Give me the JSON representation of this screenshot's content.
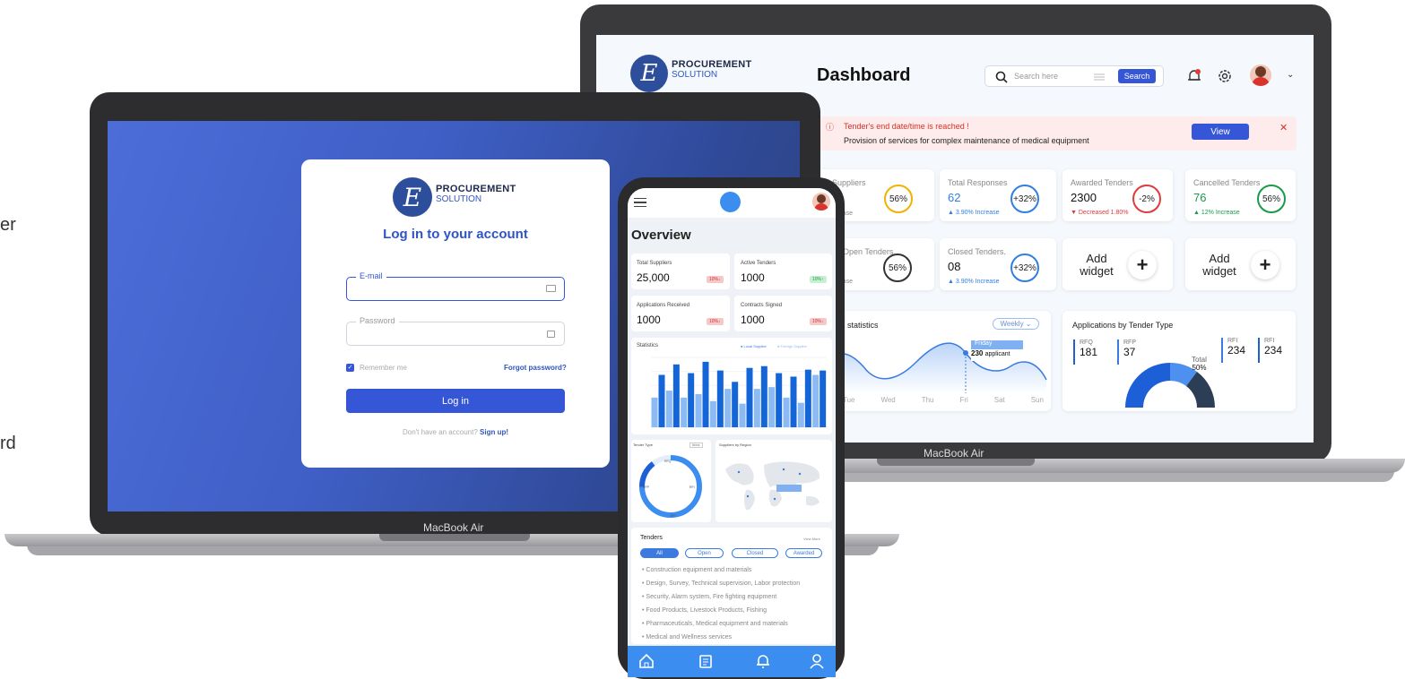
{
  "edge_text": [
    "er",
    "rd"
  ],
  "login": {
    "brand_line1": "PROCUREMENT",
    "brand_line2": "SOLUTION",
    "title": "Log in to your account",
    "email_label": "E-mail",
    "password_label": "Password",
    "remember": "Remember me",
    "forgot": "Forgot password?",
    "login_button": "Log in",
    "no_account": "Don't have an account?",
    "signup": "Sign up!",
    "device": "MacBook Air"
  },
  "dashboard": {
    "brand_line1": "PROCUREMENT",
    "brand_line2": "SOLUTION",
    "title": "Dashboard",
    "search_placeholder": "Search here",
    "search_button": "Search",
    "alert_title": "Tender's end date/time is reached !",
    "alert_text": "Provision of services for complex maintenance of medical equipment",
    "view_button": "View",
    "device": "MacBook Air",
    "stats": [
      {
        "label": "tal Suppliers",
        "value": "",
        "ring": "56%",
        "note": "% Increase",
        "ring_color": "#f0b400",
        "note_color": "#999"
      },
      {
        "label": "Total Responses",
        "value": "62",
        "ring": "+32%",
        "note": "▲ 3.90% Increase",
        "ring_color": "#2f7fe0",
        "note_color": "#2f7fe0"
      },
      {
        "label": "Awarded Tenders",
        "value": "2300",
        "ring": "-2%",
        "note": "▼ Decreased 1.80%",
        "ring_color": "#e03b3b",
        "note_color": "#e03b3b"
      },
      {
        "label": "Cancelled Tenders",
        "value": "76",
        "ring": "56%",
        "note": "▲ 12% Increase",
        "ring_color": "#1a9a4a",
        "note_color": "#1a9a4a"
      },
      {
        "label": "Open Tenders",
        "value": "",
        "ring": "56%",
        "note": "% Increase",
        "ring_color": "#333",
        "note_color": "#999"
      },
      {
        "label": "Closed Tenders.",
        "value": "08",
        "ring": "+32%",
        "note": "▲ 3.90% Increase",
        "ring_color": "#2f7fe0",
        "note_color": "#2f7fe0"
      }
    ],
    "add_widget_line1": "Add",
    "add_widget_line2": "widget",
    "supplier_stats": {
      "title": "liers statistics",
      "period": "Weekly",
      "tooltip_day": "Friday",
      "tooltip_value": "230",
      "tooltip_unit": "applicant",
      "days": [
        "Tue",
        "Wed",
        "Thu",
        "Fri",
        "Sat",
        "Sun"
      ]
    },
    "apps_by_type": {
      "title": "Applications by Tender Type",
      "items": [
        {
          "label": "RFQ",
          "value": "181"
        },
        {
          "label": "RFP",
          "value": "37"
        },
        {
          "label": "RFI",
          "value": "234"
        },
        {
          "label": "RFI",
          "value": "234"
        }
      ],
      "total_label": "Total",
      "total_value": "50%"
    }
  },
  "phone": {
    "title": "Overview",
    "cards": [
      {
        "label": "Total Suppliers",
        "value": "25,000",
        "tag": "10%↓",
        "tag_color": "#f6c9c9"
      },
      {
        "label": "Active Tenders",
        "value": "1000",
        "tag": "10%↑",
        "tag_color": "#c9efd3"
      },
      {
        "label": "Applications Received",
        "value": "1000",
        "tag": "10%↓",
        "tag_color": "#f6c9c9"
      },
      {
        "label": "Contracts Signed",
        "value": "1000",
        "tag": "10%↓",
        "tag_color": "#f6c9c9"
      }
    ],
    "statistics_title": "Statistics",
    "legend_local": "● Local Supplier",
    "legend_foreign": "● Foreign Supplier",
    "tender_type_title": "Tender Type",
    "tender_type_filter": "Items",
    "ring_labels": [
      "RFQ",
      "RFP",
      "RFI",
      "RFI"
    ],
    "suppliers_by_region": "Suppliers by Region",
    "tenders_title": "Tenders",
    "view_more": "View More",
    "filters": [
      "All",
      "Open",
      "Closed",
      "Awarded"
    ],
    "tender_list": [
      "Construction equipment and materials",
      "Design, Survey, Technical supervision, Labor protection",
      "Security, Alarm system, Fire fighting equipment",
      "Food Products, Livestock Products, Fishing",
      "Pharmaceuticals, Medical equipment and materials",
      "Medical and Wellness services"
    ]
  },
  "chart_data": {
    "type": "bar",
    "title": "Statistics",
    "series": [
      {
        "name": "Local Supplier",
        "values": [
          60,
          72,
          62,
          75,
          65,
          52,
          68,
          70,
          62,
          58,
          66,
          65
        ]
      },
      {
        "name": "Foreign Supplier",
        "values": [
          34,
          42,
          34,
          38,
          30,
          44,
          27,
          44,
          46,
          34,
          28,
          60
        ]
      }
    ]
  },
  "colors": {
    "accent": "#3556d6",
    "primary_blue": "#2f7fe0",
    "alert_bg": "#fdeceb",
    "alert_red": "#d93025"
  }
}
